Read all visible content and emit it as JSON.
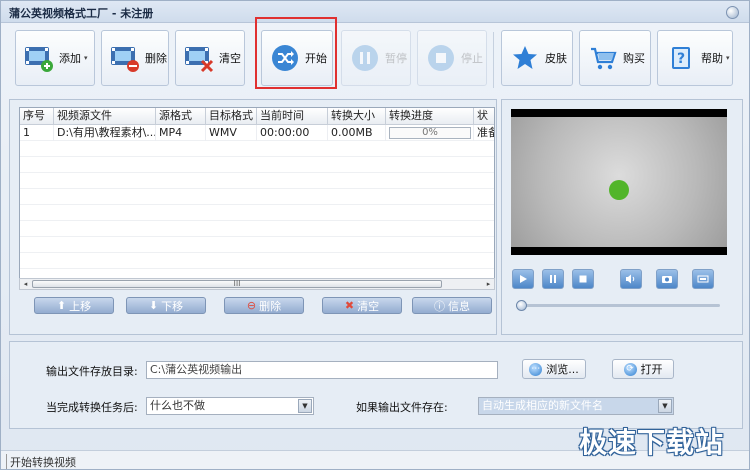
{
  "window": {
    "title": "蒲公英视频格式工厂 - 未注册"
  },
  "toolbar": {
    "add": {
      "label": "添加",
      "arrow": "▾"
    },
    "delete": {
      "label": "删除"
    },
    "clear": {
      "label": "清空"
    },
    "start": {
      "label": "开始"
    },
    "pause": {
      "label": "暂停"
    },
    "stop": {
      "label": "停止"
    },
    "skin": {
      "label": "皮肤"
    },
    "buy": {
      "label": "购买"
    },
    "help": {
      "label": "帮助",
      "arrow": "▾"
    }
  },
  "list": {
    "columns": [
      "序号",
      "视频源文件",
      "源格式",
      "目标格式",
      "当前时间",
      "转换大小",
      "转换进度",
      "状"
    ],
    "rows": [
      {
        "index": "1",
        "source": "D:\\有用\\教程素材\\...",
        "src_format": "MP4",
        "dst_format": "WMV",
        "time": "00:00:00",
        "size": "0.00MB",
        "progress_text": "0%",
        "progress": 0,
        "status": "准备"
      }
    ],
    "scrollbar_grip": "III",
    "buttons": {
      "up": "上移",
      "down": "下移",
      "delete": "删除",
      "clear": "清空",
      "info": "信息"
    }
  },
  "settings": {
    "output_dir_label": "输出文件存放目录:",
    "output_dir_value": "C:\\蒲公英视频输出",
    "browse_label": "浏览...",
    "open_label": "打开",
    "after_done_label": "当完成转换任务后:",
    "after_done_value": "什么也不做",
    "if_exists_label": "如果输出文件存在:",
    "if_exists_value": "自动生成相应的新文件名"
  },
  "status": {
    "text": "开始转换视频"
  },
  "watermark": {
    "text": "极速下载站"
  },
  "colors": {
    "accent": "#4d86c8",
    "highlight_border": "#e03030",
    "video_dot": "#52b52a"
  }
}
